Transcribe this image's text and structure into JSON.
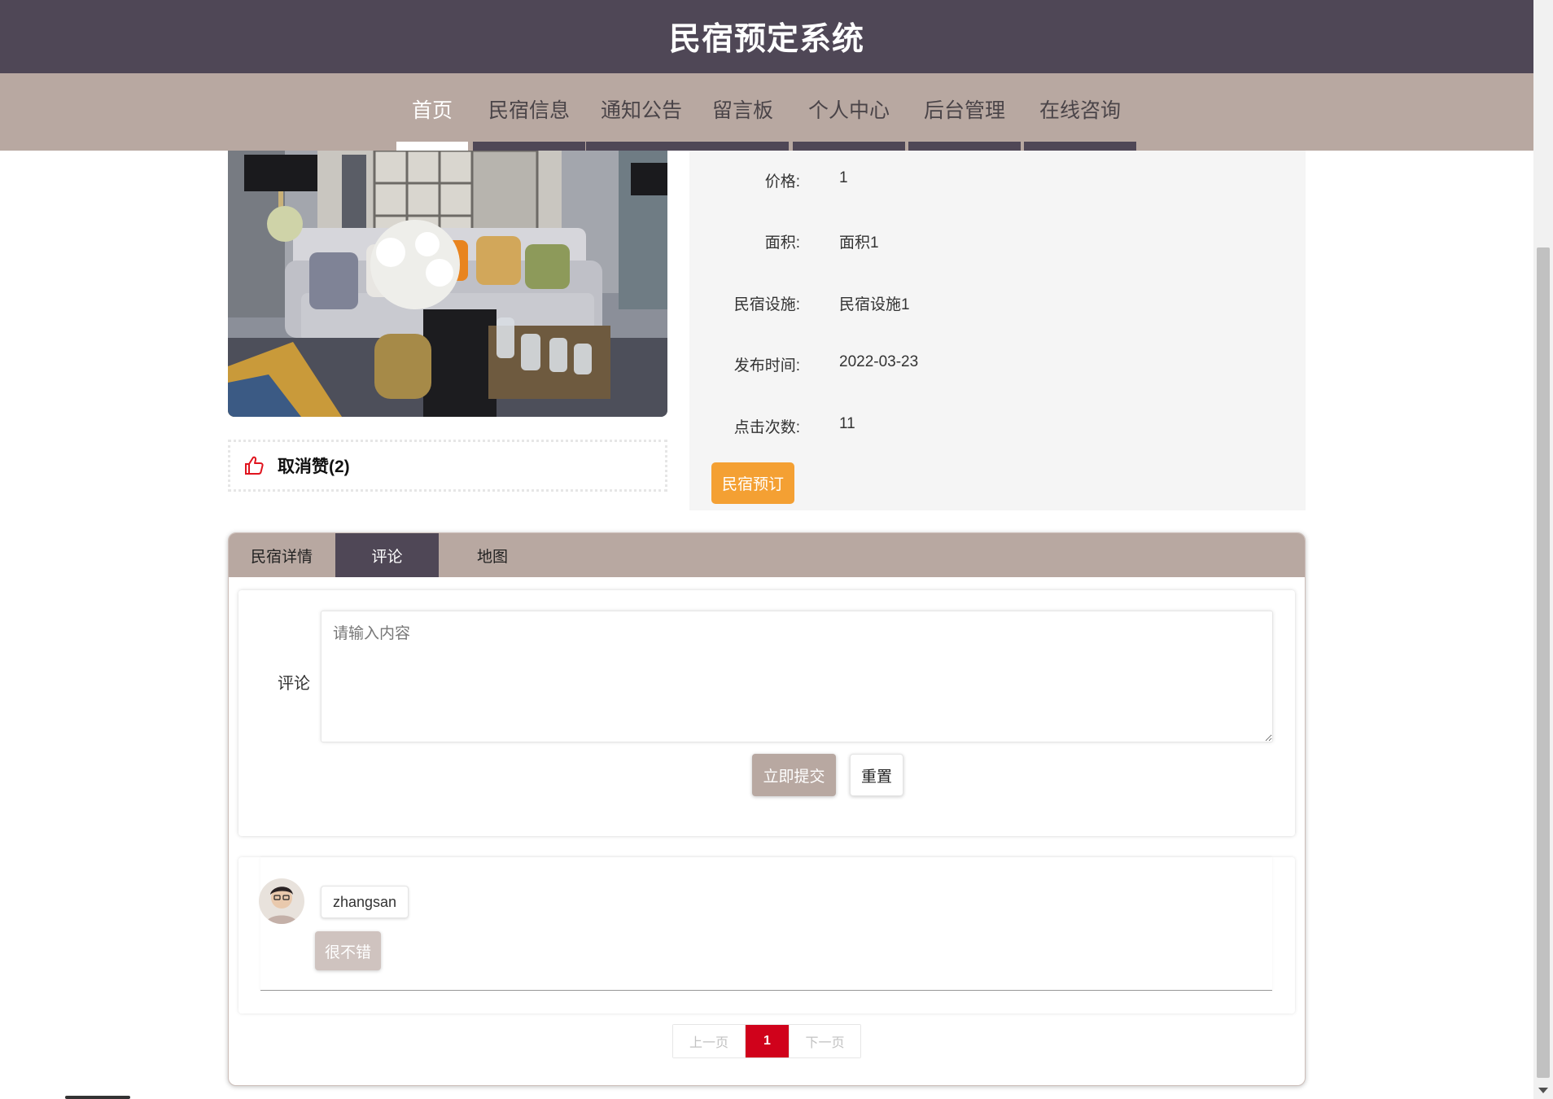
{
  "site": {
    "title": "民宿预定系统"
  },
  "nav": {
    "items": [
      {
        "label": "首页",
        "active": true
      },
      {
        "label": "民宿信息"
      },
      {
        "label": "通知公告"
      },
      {
        "label": "留言板"
      },
      {
        "label": "个人中心"
      },
      {
        "label": "后台管理"
      },
      {
        "label": "在线咨询"
      }
    ]
  },
  "like": {
    "label": "取消赞(2)",
    "icon": "thumbs-up-icon",
    "icon_color": "#e0141e"
  },
  "details": {
    "rows": [
      {
        "label": "价格:",
        "value": "1"
      },
      {
        "label": "面积:",
        "value": "面积1"
      },
      {
        "label": "民宿设施:",
        "value": "民宿设施1"
      },
      {
        "label": "发布时间:",
        "value": "2022-03-23"
      },
      {
        "label": "点击次数:",
        "value": "11"
      }
    ],
    "book_button": "民宿预订"
  },
  "tabs": [
    {
      "label": "民宿详情"
    },
    {
      "label": "评论",
      "active": true
    },
    {
      "label": "地图"
    }
  ],
  "comment_form": {
    "label": "评论",
    "placeholder": "请输入内容",
    "submit_label": "立即提交",
    "reset_label": "重置"
  },
  "comments": [
    {
      "username": "zhangsan",
      "text": "很不错"
    }
  ],
  "pagination": {
    "prev": "上一页",
    "current": "1",
    "next": "下一页"
  },
  "colors": {
    "header": "#4f4756",
    "nav": "#b8a8a1",
    "accent_orange": "#f4a033",
    "page_active": "#d0021b"
  }
}
